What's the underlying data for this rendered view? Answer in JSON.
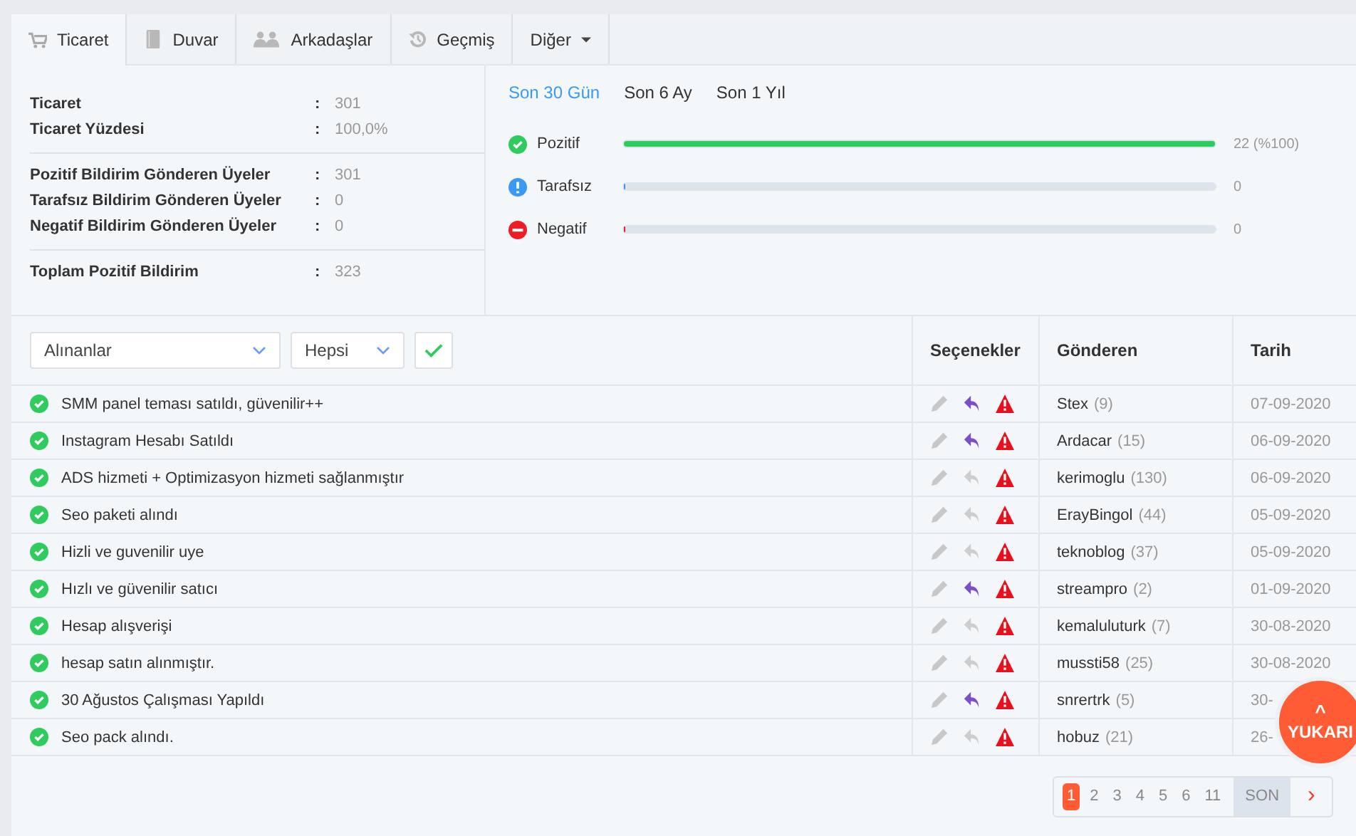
{
  "tabs": [
    {
      "label": "Ticaret",
      "selected": true
    },
    {
      "label": "Duvar",
      "selected": false
    },
    {
      "label": "Arkadaşlar",
      "selected": false
    },
    {
      "label": "Geçmiş",
      "selected": false
    },
    {
      "label": "Diğer",
      "selected": false
    }
  ],
  "stats": [
    [
      {
        "label": "Ticaret",
        "value": "301"
      },
      {
        "label": "Ticaret Yüzdesi",
        "value": "100,0%"
      }
    ],
    [
      {
        "label": "Pozitif Bildirim Gönderen Üyeler",
        "value": "301"
      },
      {
        "label": "Tarafsız Bildirim Gönderen Üyeler",
        "value": "0"
      },
      {
        "label": "Negatif Bildirim Gönderen Üyeler",
        "value": "0"
      }
    ],
    [
      {
        "label": "Toplam Pozitif Bildirim",
        "value": "323"
      }
    ]
  ],
  "stat_separator": ":",
  "periods": [
    {
      "label": "Son 30 Gün",
      "selected": true
    },
    {
      "label": "Son 6 Ay",
      "selected": false
    },
    {
      "label": "Son 1 Yıl",
      "selected": false
    }
  ],
  "ratings": [
    {
      "kind": "positive",
      "label": "Pozitif",
      "level": 1,
      "reading": "22 (%100)"
    },
    {
      "kind": "neutral",
      "label": "Tarafsız",
      "level": 0,
      "reading": "0"
    },
    {
      "kind": "negative",
      "label": "Negatif",
      "level": 0,
      "reading": "0"
    }
  ],
  "filters": {
    "type": "Alınanlar",
    "scope": "Hepsi"
  },
  "table": {
    "columns": [
      "Seçenekler",
      "Gönderen",
      "Tarih"
    ],
    "rows": [
      {
        "subject": "SMM panel teması satıldı, güvenilir++",
        "reply_active": true,
        "sender": "Stex",
        "count": "(9)",
        "date": "07-09-2020"
      },
      {
        "subject": "Instagram Hesabı Satıldı",
        "reply_active": true,
        "sender": "Ardacar",
        "count": "(15)",
        "date": "06-09-2020"
      },
      {
        "subject": "ADS hizmeti + Optimizasyon hizmeti sağlanmıştır",
        "reply_active": false,
        "sender": "kerimoglu",
        "count": "(130)",
        "date": "06-09-2020"
      },
      {
        "subject": "Seo paketi alındı",
        "reply_active": false,
        "sender": "ErayBingol",
        "count": "(44)",
        "date": "05-09-2020"
      },
      {
        "subject": "Hizli ve guvenilir uye",
        "reply_active": false,
        "sender": "teknoblog",
        "count": "(37)",
        "date": "05-09-2020"
      },
      {
        "subject": "Hızlı ve güvenilir satıcı",
        "reply_active": true,
        "sender": "streampro",
        "count": "(2)",
        "date": "01-09-2020"
      },
      {
        "subject": "Hesap alışverişi",
        "reply_active": false,
        "sender": "kemaluluturk",
        "count": "(7)",
        "date": "30-08-2020"
      },
      {
        "subject": "hesap satın alınmıştır.",
        "reply_active": false,
        "sender": "mussti58",
        "count": "(25)",
        "date": "30-08-2020"
      },
      {
        "subject": "30 Ağustos Çalışması Yapıldı",
        "reply_active": true,
        "sender": "snrertrk",
        "count": "(5)",
        "date": "30-"
      },
      {
        "subject": "Seo pack alındı.",
        "reply_active": false,
        "sender": "hobuz",
        "count": "(21)",
        "date": "26-"
      }
    ]
  },
  "pagination": {
    "pages": [
      {
        "label": "1",
        "selected": true
      },
      {
        "label": "2",
        "selected": false
      },
      {
        "label": "3",
        "selected": false
      },
      {
        "label": "4",
        "selected": false
      },
      {
        "label": "5",
        "selected": false
      },
      {
        "label": "6",
        "selected": false
      },
      {
        "label": "11",
        "selected": false
      }
    ],
    "last": "SON",
    "next": "›"
  },
  "back_to_top": {
    "arrow": "^",
    "label": "YUKARI"
  }
}
